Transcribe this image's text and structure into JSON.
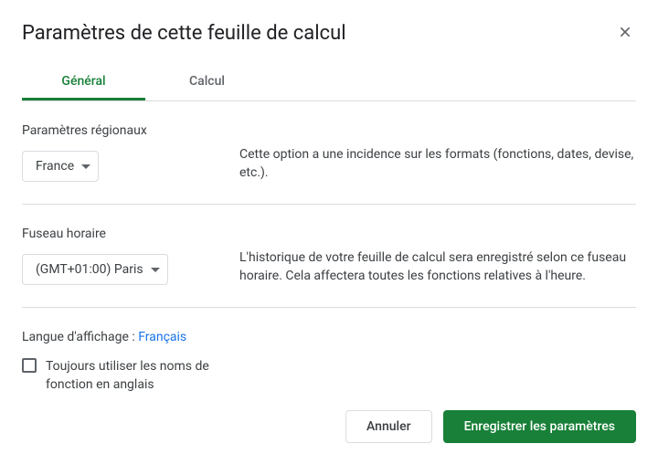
{
  "dialog": {
    "title": "Paramètres de cette feuille de calcul"
  },
  "tabs": {
    "general": "Général",
    "calculation": "Calcul"
  },
  "locale": {
    "label": "Paramètres régionaux",
    "value": "France",
    "description": "Cette option a une incidence sur les formats (fonctions, dates, devise, etc.)."
  },
  "timezone": {
    "label": "Fuseau horaire",
    "value": "(GMT+01:00) Paris",
    "description": "L'historique de votre feuille de calcul sera enregistré selon ce fuseau horaire. Cela affectera toutes les fonctions relatives à l'heure."
  },
  "language": {
    "label": "Langue d'affichage : ",
    "link": "Français",
    "checkbox_label": "Toujours utiliser les noms de fonction en anglais"
  },
  "buttons": {
    "cancel": "Annuler",
    "save": "Enregistrer les paramètres"
  }
}
